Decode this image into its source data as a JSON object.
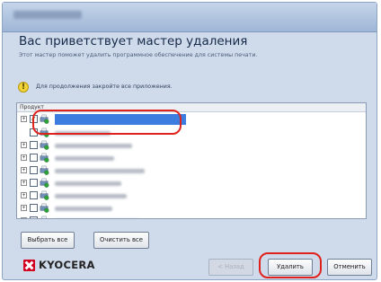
{
  "dialog": {
    "heading": "Вас приветствует мастер удаления",
    "subtitle": "Этот мастер поможет удалить программное обеспечение для системы печати.",
    "warning": "Для продолжения закройте все приложения."
  },
  "list": {
    "column_header": "Продукт",
    "rows": [
      {
        "expanded": "+",
        "checked": "✓",
        "name": "",
        "selected": true
      },
      {
        "expanded": "",
        "checked": "",
        "name": "",
        "selected": false
      },
      {
        "expanded": "+",
        "checked": "",
        "name": "",
        "selected": false
      },
      {
        "expanded": "+",
        "checked": "",
        "name": "",
        "selected": false
      },
      {
        "expanded": "+",
        "checked": "",
        "name": "",
        "selected": false
      },
      {
        "expanded": "+",
        "checked": "",
        "name": "",
        "selected": false
      },
      {
        "expanded": "+",
        "checked": "",
        "name": "",
        "selected": false
      },
      {
        "expanded": "+",
        "checked": "",
        "name": "",
        "selected": false
      },
      {
        "expanded": "+",
        "checked": "",
        "name": "",
        "selected": false
      }
    ]
  },
  "buttons": {
    "select_all": "Выбрать все",
    "clear_all": "Очистить все",
    "back": "< Назад",
    "remove": "Удалить",
    "cancel": "Отменить"
  },
  "brand": {
    "logo_text": "KYOCERA",
    "logo_color": "#d2001e"
  },
  "highlight_color": "#e0221c",
  "selection_color": "#3e7de0"
}
